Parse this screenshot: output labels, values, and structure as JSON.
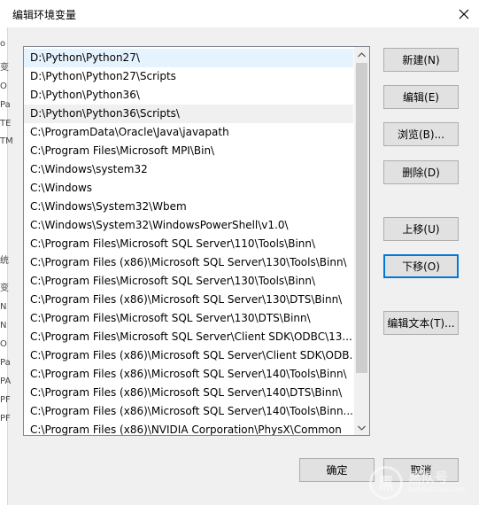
{
  "window": {
    "title": "编辑环境变量",
    "close_icon": "close-icon"
  },
  "background_window": {
    "fragments": [
      "o",
      "变",
      "O",
      "Pa",
      "TE",
      "TM",
      "统",
      "变",
      "N",
      "N",
      "O",
      "Pa",
      "PA",
      "PF",
      "PF"
    ]
  },
  "path_list": {
    "items": [
      "D:\\Python\\Python27\\",
      "D:\\Python\\Python27\\Scripts",
      "D:\\Python\\Python36\\",
      "D:\\Python\\Python36\\Scripts\\",
      "C:\\ProgramData\\Oracle\\Java\\javapath",
      "C:\\Program Files\\Microsoft MPI\\Bin\\",
      "C:\\Windows\\system32",
      "C:\\Windows",
      "C:\\Windows\\System32\\Wbem",
      "C:\\Windows\\System32\\WindowsPowerShell\\v1.0\\",
      "C:\\Program Files\\Microsoft SQL Server\\110\\Tools\\Binn\\",
      "C:\\Program Files (x86)\\Microsoft SQL Server\\130\\Tools\\Binn\\",
      "C:\\Program Files\\Microsoft SQL Server\\130\\Tools\\Binn\\",
      "C:\\Program Files (x86)\\Microsoft SQL Server\\130\\DTS\\Binn\\",
      "C:\\Program Files\\Microsoft SQL Server\\130\\DTS\\Binn\\",
      "C:\\Program Files\\Microsoft SQL Server\\Client SDK\\ODBC\\13...",
      "C:\\Program Files (x86)\\Microsoft SQL Server\\Client SDK\\ODB...",
      "C:\\Program Files (x86)\\Microsoft SQL Server\\140\\Tools\\Binn\\",
      "C:\\Program Files (x86)\\Microsoft SQL Server\\140\\DTS\\Binn\\",
      "C:\\Program Files (x86)\\Microsoft SQL Server\\140\\Tools\\Binn...",
      "C:\\Program Files (x86)\\NVIDIA Corporation\\PhysX\\Common"
    ],
    "hovered_index": 0,
    "selected_index": 3,
    "scroll_up_icon": "chevron-up-icon",
    "scroll_down_icon": "chevron-down-icon"
  },
  "buttons": {
    "new": "新建(N)",
    "edit": "编辑(E)",
    "browse": "浏览(B)...",
    "delete": "删除(D)",
    "move_up": "上移(U)",
    "move_down": "下移(O)",
    "edit_text": "编辑文本(T)...",
    "ok": "确定",
    "cancel": "取消"
  },
  "watermark": {
    "logo": "黑",
    "text": "黑队号",
    "sub": "heiduihao.com"
  },
  "colors": {
    "hover_row": "#e5f3ff",
    "default_button_border": "#0078d7"
  }
}
